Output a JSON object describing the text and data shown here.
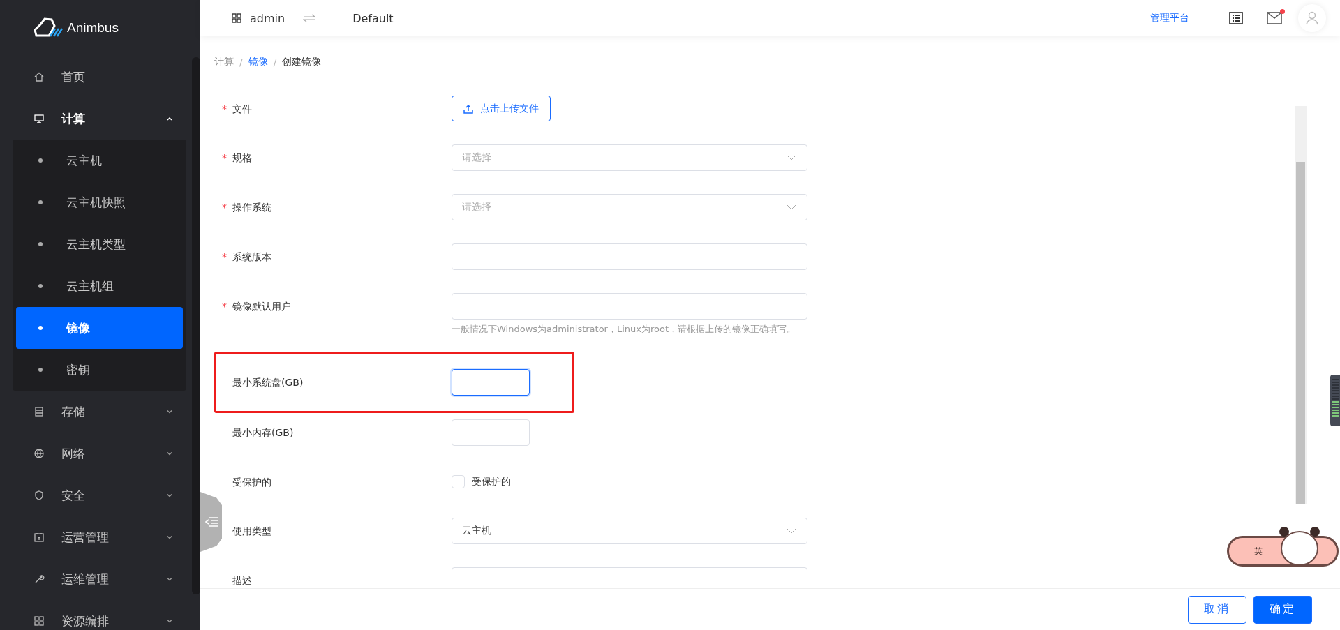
{
  "brand": {
    "name": "Animbus"
  },
  "header": {
    "user": "admin",
    "project": "Default",
    "link": "管理平台",
    "has_unread": true
  },
  "sidebar": {
    "items": [
      {
        "label": "首页"
      },
      {
        "label": "计算",
        "expanded": true,
        "children": [
          {
            "label": "云主机",
            "selected": false
          },
          {
            "label": "云主机快照",
            "selected": false
          },
          {
            "label": "云主机类型",
            "selected": false
          },
          {
            "label": "云主机组",
            "selected": false
          },
          {
            "label": "镜像",
            "selected": true
          },
          {
            "label": "密钥",
            "selected": false
          }
        ]
      },
      {
        "label": "存储",
        "expanded": false
      },
      {
        "label": "网络",
        "expanded": false
      },
      {
        "label": "安全",
        "expanded": false
      },
      {
        "label": "运营管理",
        "expanded": false
      },
      {
        "label": "运维管理",
        "expanded": false
      },
      {
        "label": "资源编排",
        "expanded": false
      }
    ]
  },
  "breadcrumb": {
    "separator": "/",
    "items": [
      {
        "label": "计算",
        "link": false
      },
      {
        "label": "镜像",
        "link": true
      },
      {
        "label": "创建镜像",
        "link": false
      }
    ]
  },
  "form": {
    "required_mark": "*",
    "fields": [
      {
        "label": "文件",
        "required": true,
        "kind": "upload",
        "button": "点击上传文件"
      },
      {
        "label": "规格",
        "required": true,
        "kind": "select",
        "placeholder": "请选择"
      },
      {
        "label": "操作系统",
        "required": true,
        "kind": "select",
        "placeholder": "请选择"
      },
      {
        "label": "系统版本",
        "required": true,
        "kind": "input"
      },
      {
        "label": "镜像默认用户",
        "required": true,
        "kind": "input",
        "hint": "一般情况下Windows为administrator，Linux为root，请根据上传的镜像正确填写。"
      },
      {
        "label": "最小系统盘(GB)",
        "required": false,
        "kind": "number",
        "focused": true,
        "highlighted": true
      },
      {
        "label": "最小内存(GB)",
        "required": false,
        "kind": "number",
        "focused": false
      },
      {
        "label": "受保护的",
        "required": false,
        "kind": "checkbox",
        "option": "受保护的",
        "checked": false
      },
      {
        "label": "使用类型",
        "required": false,
        "kind": "select",
        "value": "云主机"
      },
      {
        "label": "描述",
        "required": false,
        "kind": "textarea"
      }
    ]
  },
  "footer": {
    "buttons": [
      {
        "label": "取消",
        "kind": "default"
      },
      {
        "label": "确定",
        "kind": "primary"
      }
    ]
  },
  "ime": {
    "mode": "英"
  }
}
